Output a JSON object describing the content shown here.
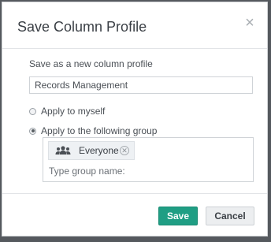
{
  "dialog": {
    "title": "Save Column Profile",
    "close_icon": "close-icon",
    "new_profile_label": "Save as a new column profile",
    "profile_name_value": "Records Management",
    "options": [
      {
        "label": "Apply to myself",
        "checked": false
      },
      {
        "label": "Apply to the following group",
        "checked": true
      }
    ],
    "group": {
      "tags": [
        {
          "label": "Everyone",
          "icon": "users-icon"
        }
      ],
      "input_placeholder": "Type group name:"
    },
    "buttons": {
      "save": "Save",
      "cancel": "Cancel"
    }
  },
  "colors": {
    "save_button": "#1f9e84",
    "overlay": "#55595e"
  }
}
